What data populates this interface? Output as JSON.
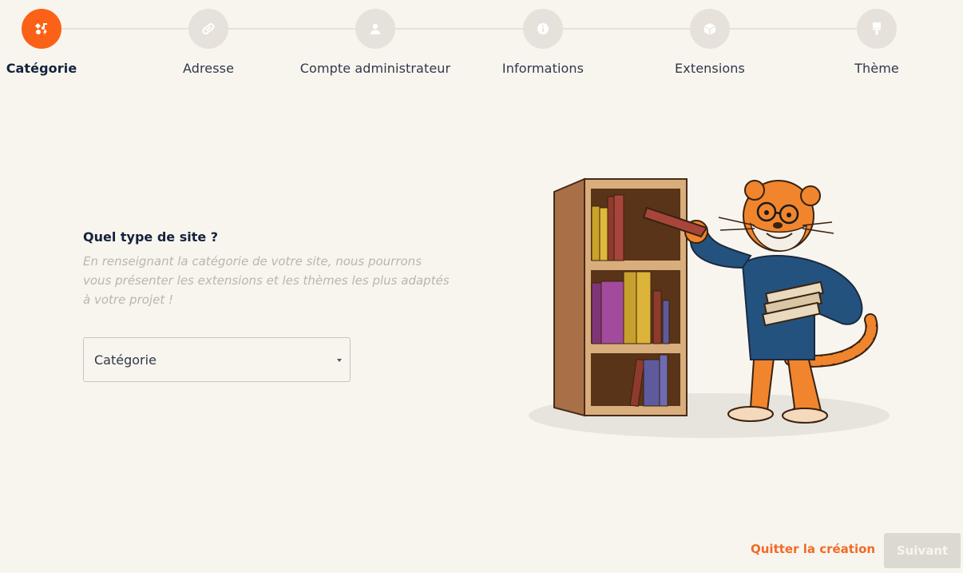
{
  "stepper": {
    "steps": [
      {
        "label": "Catégorie",
        "icon": "shapes-icon",
        "active": true
      },
      {
        "label": "Adresse",
        "icon": "link-icon",
        "active": false
      },
      {
        "label": "Compte administrateur",
        "icon": "user-icon",
        "active": false
      },
      {
        "label": "Informations",
        "icon": "info-icon",
        "active": false
      },
      {
        "label": "Extensions",
        "icon": "cube-icon",
        "active": false
      },
      {
        "label": "Thème",
        "icon": "paint-roller-icon",
        "active": false
      }
    ]
  },
  "form": {
    "title": "Quel type de site ?",
    "description": "En renseignant la catégorie de votre site, nous pourrons vous présenter les extensions et les thèmes les plus adaptés à votre projet !",
    "category_select": {
      "value": "Catégorie"
    }
  },
  "footer": {
    "quit_label": "Quitter la création",
    "next_label": "Suivant"
  },
  "colors": {
    "accent": "#fb6218",
    "background": "#f8f5ef",
    "inactive_step": "#e6e2db",
    "link": "#f16a25",
    "disabled_button": "#dcd9d3"
  }
}
